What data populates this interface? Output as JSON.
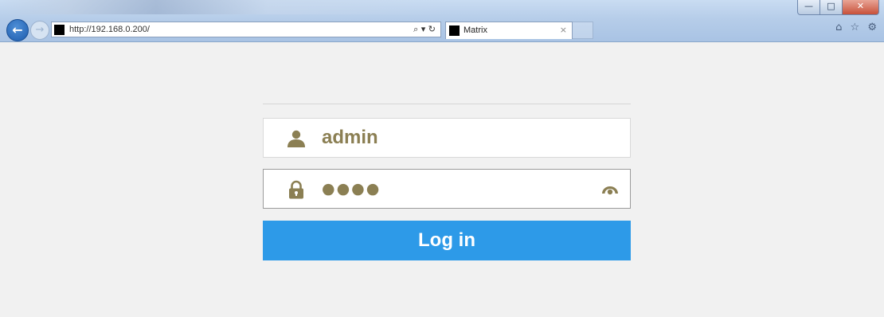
{
  "browser": {
    "url": "http://192.168.0.200/",
    "tab_title": "Matrix",
    "tab_close": "×",
    "addr_icons": "⌕ ▾ ↻",
    "toolbar_icons": "⌂ ☆ ⚙",
    "window_controls": {
      "minimize": "—",
      "maximize": "□",
      "close": "✕"
    }
  },
  "login": {
    "username_value": "admin",
    "password_masked": "●●●●",
    "login_label": "Log in"
  },
  "colors": {
    "accent": "#2d9ae8",
    "field_text": "#8b7f53",
    "page_bg": "#f1f1f1"
  }
}
